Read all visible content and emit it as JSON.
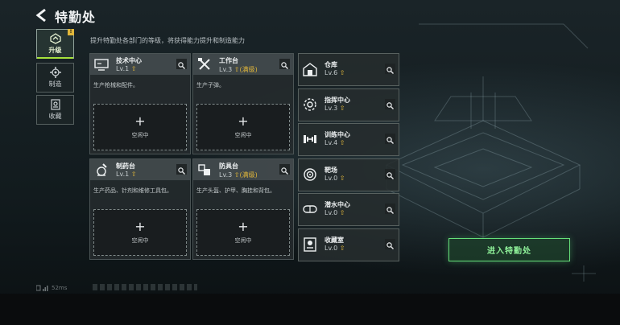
{
  "header": {
    "title": "特勤处",
    "subtitle": "提升特勤处各部门的等级，将获得能力提升和制造能力"
  },
  "tabs": [
    {
      "label": "升级",
      "icon": "upgrade-icon",
      "badge": "!"
    },
    {
      "label": "制造",
      "icon": "gear-craft-icon"
    },
    {
      "label": "收藏",
      "icon": "collection-icon"
    }
  ],
  "cards": [
    {
      "name": "技术中心",
      "level": "Lv.1",
      "max_tag": "",
      "desc": "生产枪械和配件。",
      "slot_label": "空闲中",
      "icon": "computer-icon"
    },
    {
      "name": "工作台",
      "level": "Lv.3",
      "max_tag": "(满级)",
      "desc": "生产子弹。",
      "slot_label": "空闲中",
      "icon": "tools-icon"
    },
    {
      "name": "制药台",
      "level": "Lv.1",
      "max_tag": "",
      "desc": "生产药品、针剂和维修工具包。",
      "slot_label": "空闲中",
      "icon": "pharmacy-icon"
    },
    {
      "name": "防具台",
      "level": "Lv.3",
      "max_tag": "(满级)",
      "desc": "生产头盔、护甲、胸挂和背包。",
      "slot_label": "空闲中",
      "icon": "armor-icon"
    }
  ],
  "rooms": [
    {
      "name": "仓库",
      "level": "Lv.6",
      "icon": "warehouse-icon"
    },
    {
      "name": "指挥中心",
      "level": "Lv.3",
      "icon": "command-center-icon"
    },
    {
      "name": "训练中心",
      "level": "Lv.4",
      "icon": "dumbbell-icon"
    },
    {
      "name": "靶场",
      "level": "Lv.0",
      "icon": "target-icon"
    },
    {
      "name": "潜水中心",
      "level": "Lv.0",
      "icon": "diving-mask-icon"
    },
    {
      "name": "收藏室",
      "level": "Lv.0",
      "icon": "trophy-room-icon"
    }
  ],
  "enter_button": {
    "label": "进入特勤处"
  },
  "status": {
    "ping": "52ms"
  },
  "colors": {
    "accent_green": "#8ff29a",
    "level_arrow": "#e0b63a",
    "active_tab_underline": "#a7e23c"
  }
}
